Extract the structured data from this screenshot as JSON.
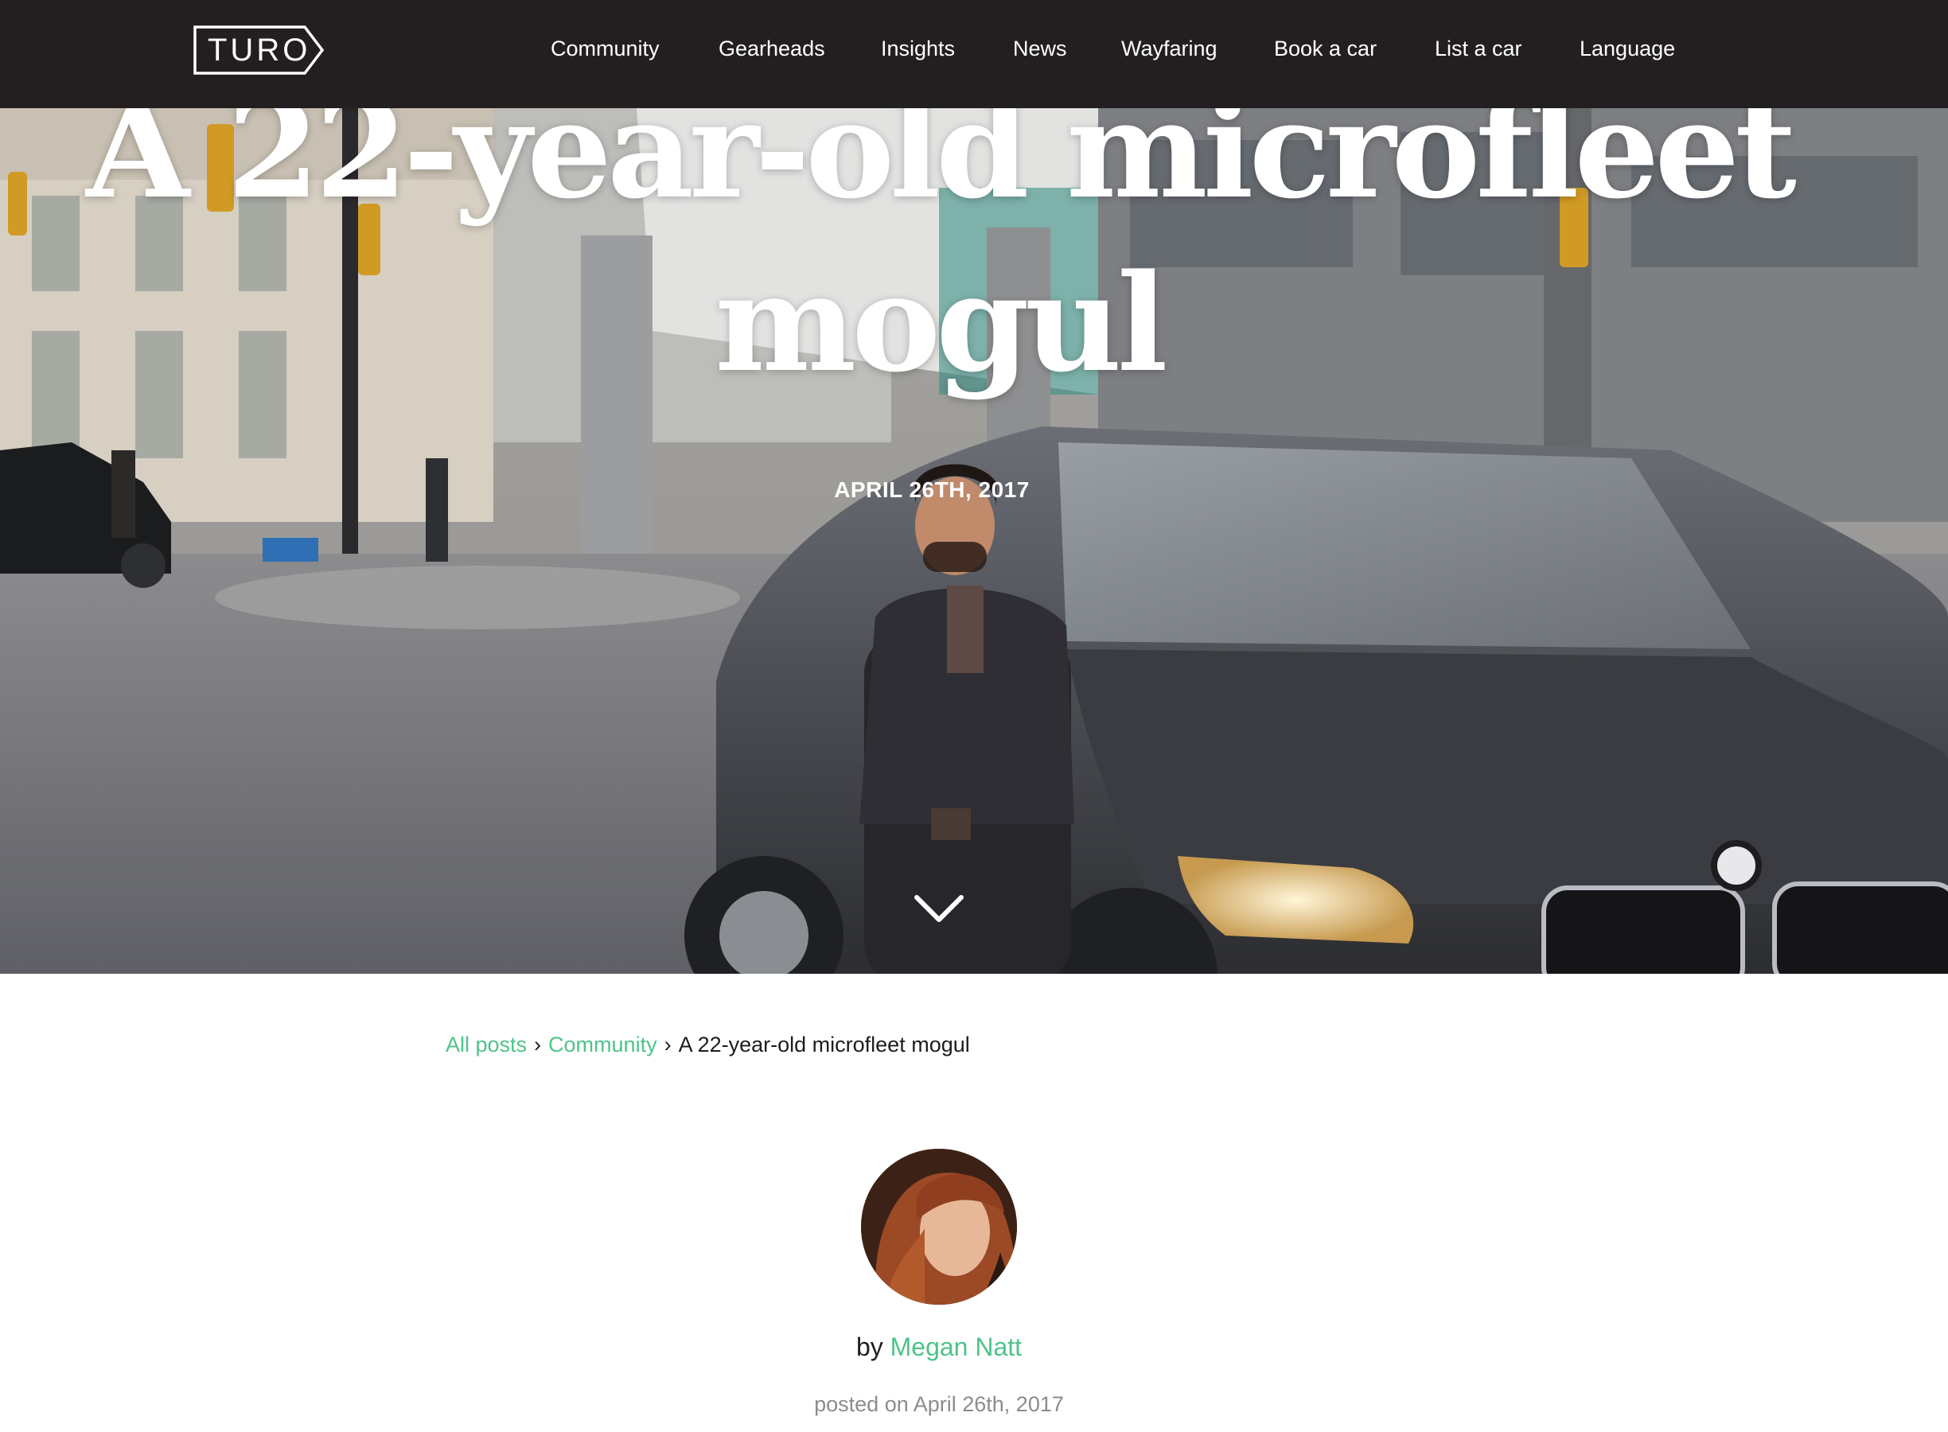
{
  "nav": {
    "logo": "TURO",
    "items": [
      "Community",
      "Gearheads",
      "Insights",
      "News",
      "Wayfaring",
      "Book a car",
      "List a car",
      "Language"
    ]
  },
  "hero": {
    "title": "A 22-year-old microfleet mogul",
    "date": "APRIL 26TH, 2017",
    "scroll_icon": "chevron-down-icon"
  },
  "breadcrumb": {
    "all_posts": "All posts",
    "separator": "›",
    "category": "Community",
    "current": "A 22-year-old microfleet mogul"
  },
  "author": {
    "by": "by",
    "name": "Megan Natt",
    "posted": "posted on April 26th, 2017"
  },
  "colors": {
    "nav_bg": "#231f20",
    "accent_green": "#4ec38a",
    "muted_text": "#8c8c8c"
  }
}
